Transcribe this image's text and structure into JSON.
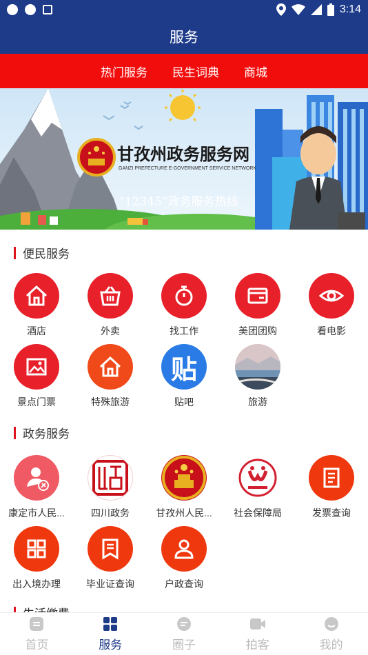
{
  "status": {
    "time": "3:14"
  },
  "header": {
    "title": "服务"
  },
  "tabs": [
    {
      "label": "热门服务"
    },
    {
      "label": "民生词典"
    },
    {
      "label": "商城"
    }
  ],
  "banner": {
    "title": "甘孜州政务服务网",
    "subtitle": "GANZI PREFECTURE E-GOVERNMENT SERVICE NETWORK",
    "hotline": "“12345”政务服务热线"
  },
  "sections": {
    "convenience": {
      "title": "便民服务",
      "items": [
        {
          "label": "酒店",
          "icon": "home-icon",
          "color": "#e8202a"
        },
        {
          "label": "外卖",
          "icon": "basket-icon",
          "color": "#e8202a"
        },
        {
          "label": "找工作",
          "icon": "stopwatch-icon",
          "color": "#e8202a"
        },
        {
          "label": "美团团购",
          "icon": "card-icon",
          "color": "#e8202a"
        },
        {
          "label": "看电影",
          "icon": "eye-icon",
          "color": "#e8202a"
        },
        {
          "label": "景点门票",
          "icon": "image-icon",
          "color": "#e8202a"
        },
        {
          "label": "特殊旅游",
          "icon": "home-icon",
          "color": "#f04a1a"
        },
        {
          "label": "贴吧",
          "icon": "tieba-icon",
          "color": "#2a7be6"
        },
        {
          "label": "旅游",
          "icon": "landscape-photo",
          "color": "#7a9cb8"
        }
      ]
    },
    "government": {
      "title": "政务服务",
      "items": [
        {
          "label": "康定市人民...",
          "icon": "party-user-icon",
          "color": "#f05a64"
        },
        {
          "label": "四川政务",
          "icon": "seal-icon",
          "color": "#ffffff"
        },
        {
          "label": "甘孜州人民...",
          "icon": "emblem-icon",
          "color": "#c8101a"
        },
        {
          "label": "社会保障局",
          "icon": "social-security-logo",
          "color": "#ffffff"
        },
        {
          "label": "发票查询",
          "icon": "document-icon",
          "color": "#f0380e"
        },
        {
          "label": "出入境办理",
          "icon": "grid-icon",
          "color": "#f0380e"
        },
        {
          "label": "毕业证查询",
          "icon": "certificate-icon",
          "color": "#f0380e"
        },
        {
          "label": "户政查询",
          "icon": "person-icon",
          "color": "#f0380e"
        }
      ]
    },
    "life": {
      "title": "生活缴费"
    }
  },
  "bottom_nav": [
    {
      "label": "首页",
      "icon": "home-doc-icon"
    },
    {
      "label": "服务",
      "icon": "apps-icon"
    },
    {
      "label": "圈子",
      "icon": "chat-icon"
    },
    {
      "label": "拍客",
      "icon": "video-icon"
    },
    {
      "label": "我的",
      "icon": "profile-icon"
    }
  ]
}
